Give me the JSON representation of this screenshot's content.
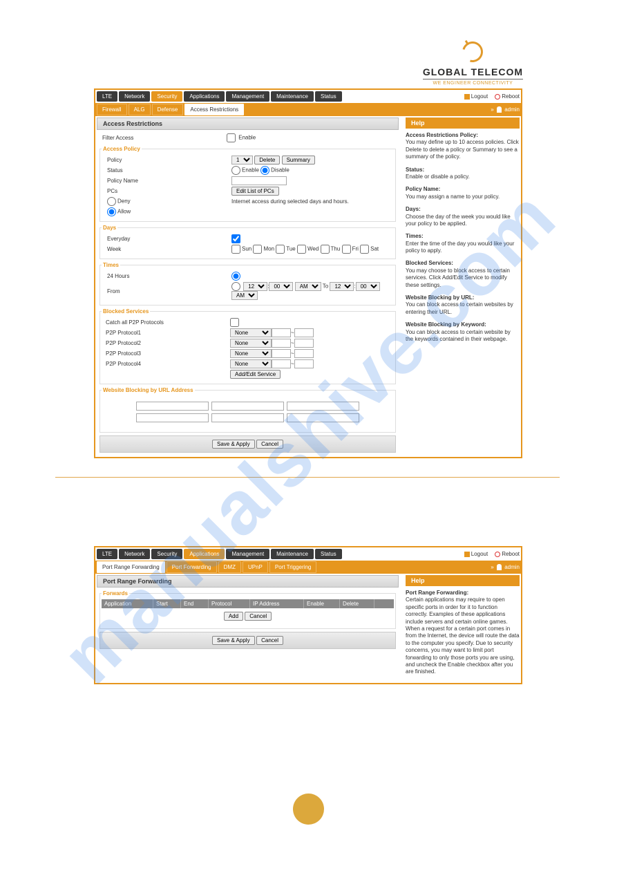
{
  "brand": {
    "name": "GLOBAL TELECOM",
    "tagline": "WE ENGINEER CONNECTIVITY"
  },
  "top": {
    "logout": "Logout",
    "reboot": "Reboot",
    "user_lang": "»",
    "user": "admin"
  },
  "primary_tabs": [
    "LTE",
    "Network",
    "Security",
    "Applications",
    "Management",
    "Maintenance",
    "Status"
  ],
  "router1": {
    "active_primary": "Security",
    "subtabs": [
      "Firewall",
      "ALG",
      "Defense",
      "Access Restrictions"
    ],
    "active_sub": "Access Restrictions",
    "section_title": " Access Restrictions",
    "filter_access": "Filter Access",
    "enable": "Enable",
    "access_policy": {
      "legend": "Access Policy",
      "policy": "Policy",
      "policy_value": "1",
      "delete": "Delete",
      "summary": "Summary",
      "status": "Status",
      "disable": "Disable",
      "policy_name": "Policy Name",
      "pcs": "PCs",
      "edit_list": "Edit List of PCs",
      "deny": "Deny",
      "allow": "Allow",
      "note": "Internet access during selected days and hours."
    },
    "days": {
      "legend": "Days",
      "everyday": "Everyday",
      "week": "Week",
      "sun": "Sun",
      "mon": "Mon",
      "tue": "Tue",
      "wed": "Wed",
      "thu": "Thu",
      "fri": "Fri",
      "sat": "Sat"
    },
    "times": {
      "legend": "Times",
      "24h": "24 Hours",
      "from": "From",
      "to": "To",
      "h": "12",
      "m": "00",
      "ampm": "AM"
    },
    "blocked": {
      "legend": "Blocked Services",
      "catch": "Catch all P2P Protocols",
      "p1": "P2P Protocol1",
      "p2": "P2P Protocol2",
      "p3": "P2P Protocol3",
      "p4": "P2P Protocol4",
      "none": "None",
      "addedit": "Add/Edit Service"
    },
    "url_block": {
      "legend": "Website Blocking by URL Address"
    },
    "save": "Save & Apply",
    "cancel": "Cancel"
  },
  "help1": {
    "title": "Help",
    "p_policy_h": "Access Restrictions Policy:",
    "p_policy": "You may define up to 10 access policies. Click Delete to delete a policy or Summary to see a summary of the policy.",
    "status_h": "Status:",
    "status": "Enable or disable a policy.",
    "name_h": "Policy Name:",
    "name": "You may assign a name to your policy.",
    "days_h": "Days:",
    "days": "Choose the day of the week you would like your policy to be applied.",
    "times_h": "Times:",
    "times": "Enter the time of the day you would like your policy to apply.",
    "bs_h": "Blocked Services:",
    "bs": "You may choose to block access to certain services. Click Add/Edit Service to modify these settings.",
    "wburl_h": "Website Blocking by URL:",
    "wburl": "You can block access to certain websites by entering their URL.",
    "wbk_h": "Website Blocking by Keyword:",
    "wbk": "You can block access to certain website by the keywords contained in their webpage."
  },
  "router2": {
    "active_primary": "Applications",
    "subtabs": [
      "Port Range Forwarding",
      "Port Forwarding",
      "DMZ",
      "UPnP",
      "Port Triggering"
    ],
    "active_sub": "Port Range Forwarding",
    "section_title": " Port Range Forwarding",
    "forwards_legend": "Forwards",
    "cols": {
      "app": "Application",
      "start": "Start",
      "end": "End",
      "proto": "Protocol",
      "ip": "IP Address",
      "enable": "Enable",
      "delete": "Delete"
    },
    "add": "Add",
    "cancel": "Cancel",
    "save": "Save & Apply"
  },
  "help2": {
    "title": "Help",
    "h": "Port Range Forwarding:",
    "body": "Certain applications may require to open specific ports in order for it to function correctly. Examples of these applications include servers and certain online games. When a request for a certain port comes in from the Internet, the device will route the data to the computer you specify. Due to security concerns, you may want to limit port forwarding to only those ports you are using, and uncheck the Enable checkbox after you are finished."
  }
}
